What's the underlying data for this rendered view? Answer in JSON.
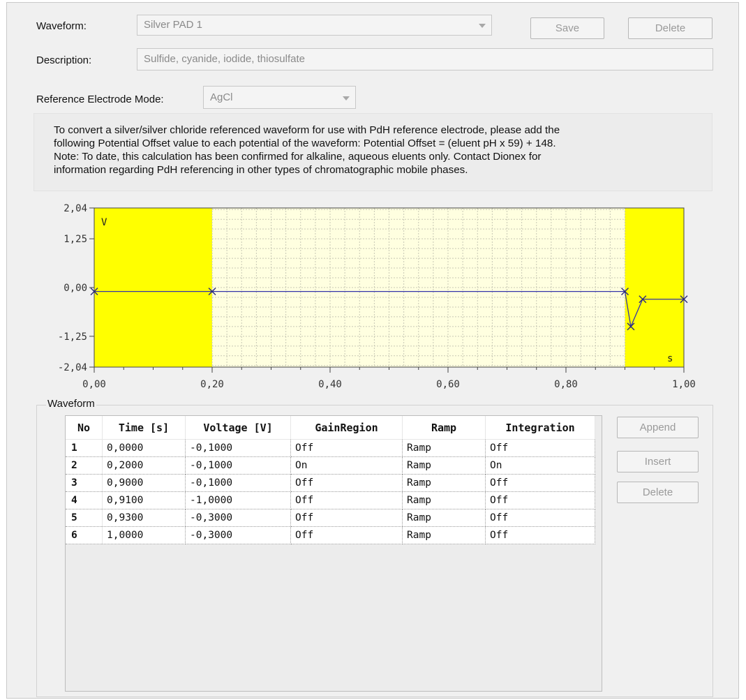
{
  "form": {
    "waveform_label": "Waveform:",
    "waveform_value": "Silver PAD 1",
    "save_label": "Save",
    "delete_label": "Delete",
    "description_label": "Description:",
    "description_value": "Sulfide, cyanide, iodide, thiosulfate",
    "ref_mode_label": "Reference Electrode Mode:",
    "ref_mode_value": "AgCl"
  },
  "info_text": [
    "To convert a silver/silver chloride referenced waveform for use with PdH reference electrode, please add the",
    "following Potential Offset value to each potential of the waveform: Potential Offset = (eluent pH  x 59) + 148.",
    "Note: To date, this calculation has been confirmed for alkaline, aqueous eluents only. Contact Dionex for",
    "information regarding PdH referencing in other types of chromatographic mobile phases."
  ],
  "chart_data": {
    "type": "line",
    "xlabel": "s",
    "ylabel": "V",
    "xlim": [
      0,
      1
    ],
    "ylim": [
      -2.04,
      2.04
    ],
    "x_ticks": [
      "0,00",
      "0,20",
      "0,40",
      "0,60",
      "0,80",
      "1,00"
    ],
    "y_ticks": [
      "2,04",
      "1,25",
      "0,00",
      "-1,25",
      "-2,04"
    ],
    "gain_region": [
      0.2,
      0.9
    ],
    "series": [
      {
        "x": [
          0.0,
          0.2,
          0.9,
          0.91,
          0.93,
          1.0
        ],
        "y": [
          -0.1,
          -0.1,
          -0.1,
          -1.0,
          -0.3,
          -0.3
        ]
      }
    ],
    "colors": {
      "outside": "#ffff00",
      "gain": "#ffffe0",
      "line": "#3333aa",
      "marker": "#2a2a7a"
    }
  },
  "waveform_group": {
    "title": "Waveform",
    "columns": [
      "No",
      "Time [s]",
      "Voltage [V]",
      "GainRegion",
      "Ramp",
      "Integration"
    ],
    "rows": [
      [
        "1",
        "0,0000",
        "-0,1000",
        "Off",
        "Ramp",
        "Off"
      ],
      [
        "2",
        "0,2000",
        "-0,1000",
        "On",
        "Ramp",
        "On"
      ],
      [
        "3",
        "0,9000",
        "-0,1000",
        "Off",
        "Ramp",
        "Off"
      ],
      [
        "4",
        "0,9100",
        "-1,0000",
        "Off",
        "Ramp",
        "Off"
      ],
      [
        "5",
        "0,9300",
        "-0,3000",
        "Off",
        "Ramp",
        "Off"
      ],
      [
        "6",
        "1,0000",
        "-0,3000",
        "Off",
        "Ramp",
        "Off"
      ]
    ],
    "append_label": "Append",
    "insert_label": "Insert",
    "delete_label": "Delete"
  }
}
